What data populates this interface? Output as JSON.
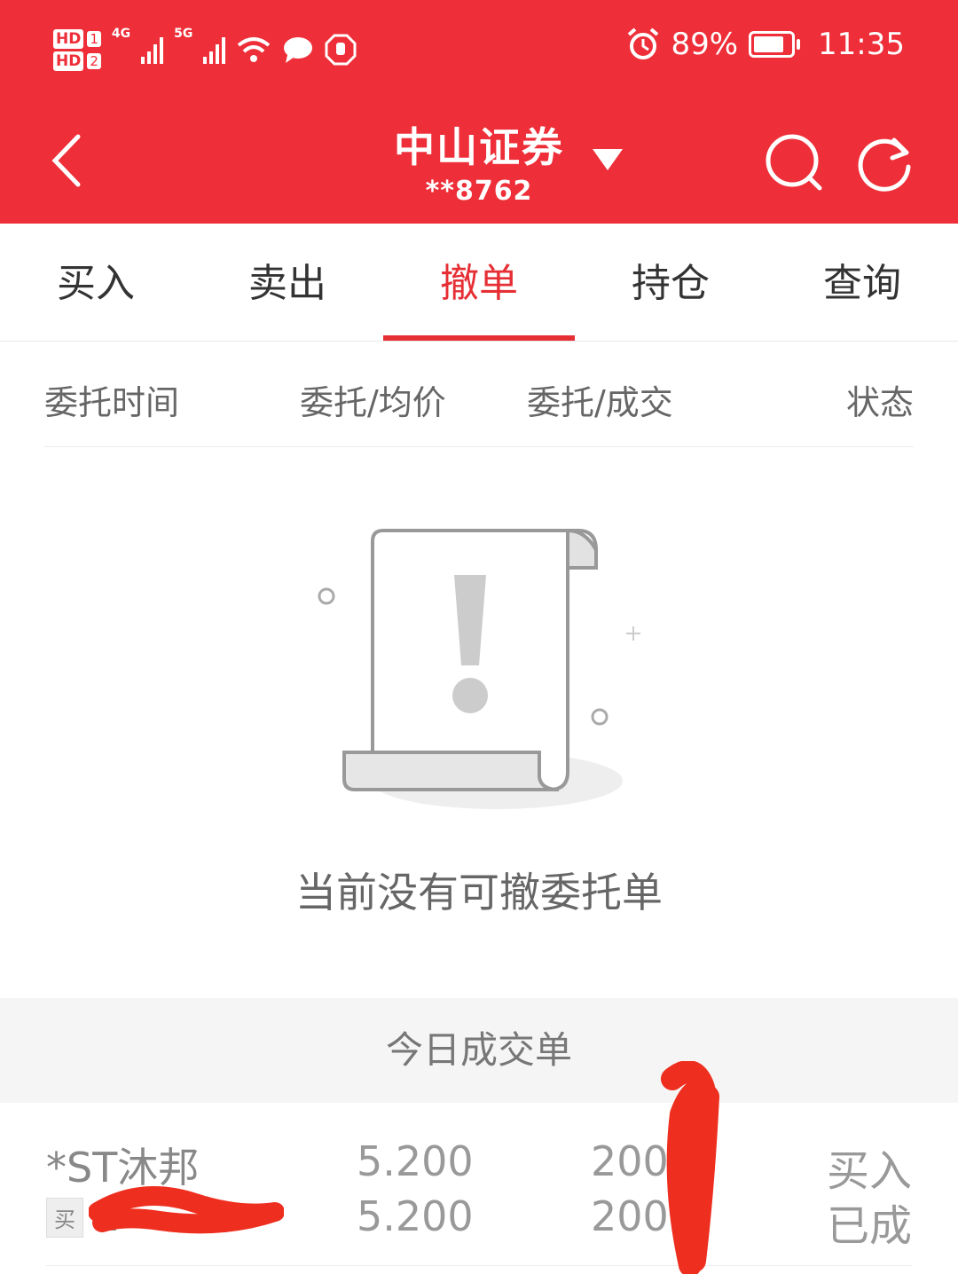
{
  "status_bar": {
    "sim1_label": "HD",
    "sim1_num": "1",
    "sim2_label": "HD",
    "sim2_num": "2",
    "net1": "4G",
    "net2": "5G",
    "battery": "89%",
    "time": "11:35"
  },
  "header": {
    "title": "中山证券",
    "account": "**8762",
    "bg_color": "#ee2e38"
  },
  "tabs": [
    {
      "label": "买入"
    },
    {
      "label": "卖出"
    },
    {
      "label": "撤单",
      "active": true
    },
    {
      "label": "持仓"
    },
    {
      "label": "查询"
    }
  ],
  "columns": {
    "time": "委托时间",
    "price": "委托/均价",
    "qty": "委托/成交",
    "status": "状态"
  },
  "empty_state": {
    "message": "当前没有可撤委托单"
  },
  "today_deals": {
    "title": "今日成交单",
    "rows": [
      {
        "name": "*ST沐邦",
        "side_tag": "买",
        "code": "1",
        "order_price": "5.200",
        "avg_price": "5.200",
        "order_qty": "200",
        "filled_qty": "200",
        "direction": "买入",
        "status": "已成"
      }
    ]
  }
}
